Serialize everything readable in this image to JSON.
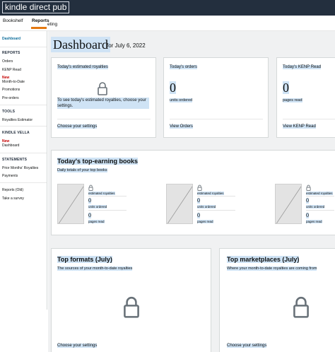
{
  "topbar": {
    "logo_text": "kindle direct pub"
  },
  "subnav": {
    "tabs": [
      {
        "label": "Bookshelf"
      },
      {
        "label": "Reports"
      }
    ],
    "cut_text": "eting"
  },
  "sidebar": {
    "dashboard": "Dashboard",
    "reports_heading": "REPORTS",
    "orders": "Orders",
    "kenp_read": "KENP Read",
    "new_label": "New",
    "month_to_date": "Month-to-Date",
    "promotions": "Promotions",
    "pre_orders": "Pre-orders",
    "tools_heading": "TOOLS",
    "royalties_estimator": "Royalties Estimator",
    "kindle_vella_heading": "KINDLE VELLA",
    "vella_new": "New",
    "vella_dashboard": "Dashboard",
    "statements_heading": "STATEMENTS",
    "prior_months": "Prior Months' Royalties",
    "payments": "Payments",
    "reports_old": "Reports (Old)",
    "take_survey": "Take a survey"
  },
  "page": {
    "title": "Dashboard",
    "date": "for July 6, 2022"
  },
  "cards": {
    "royalties": {
      "title": "Today's estimated royalties",
      "message": "To see today's estimated royalties, choose your settings.",
      "link": "Choose your settings"
    },
    "orders": {
      "title": "Today's orders",
      "value": "0",
      "unit": "units ordered",
      "link": "View Orders"
    },
    "kenp": {
      "title": "Today's KENP Read",
      "value": "0",
      "unit": "pages read",
      "link": "View KENP Read"
    }
  },
  "top_books": {
    "title": "Today's top-earning books",
    "subtitle": "Daily totals of your top books",
    "items": [
      {
        "royalties_label": "estimated royalties",
        "units": "0",
        "units_label": "units ordered",
        "pages": "0",
        "pages_label": "pages read"
      },
      {
        "royalties_label": "estimated royalties",
        "units": "0",
        "units_label": "units ordered",
        "pages": "0",
        "pages_label": "pages read"
      },
      {
        "royalties_label": "estimated royalties",
        "units": "0",
        "units_label": "units ordered",
        "pages": "0",
        "pages_label": "pages read"
      }
    ]
  },
  "top_formats": {
    "title": "Top formats (July)",
    "subtitle": "The sources of your month-to-date royalties",
    "link": "Choose your settings"
  },
  "top_marketplaces": {
    "title": "Top marketplaces (July)",
    "subtitle": "Where your month-to-date royalties are coming from",
    "link": "Choose your settings"
  },
  "colors": {
    "topbar": "#232f3e",
    "highlight": "#cfe3f5",
    "accent": "#e47911",
    "new_badge": "#c40000"
  },
  "icons": [
    "lock-icon",
    "book-placeholder-icon"
  ]
}
